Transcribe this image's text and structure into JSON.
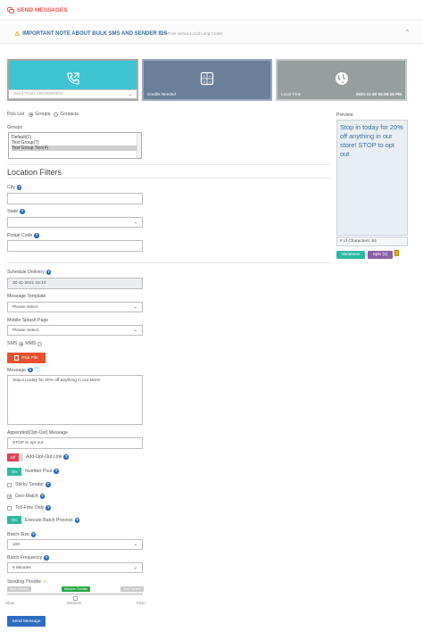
{
  "header": {
    "title": "SEND MESSAGES"
  },
  "note": {
    "title": "IMPORTANT NOTE ABOUT BULK SMS AND SENDER IDS",
    "subtitle": "Toll-Free versus Local Long Codes"
  },
  "tiles": {
    "send_from": {
      "value": "Send From: 18445283544"
    },
    "credits": {
      "label": "Credits Needed"
    },
    "local_time": {
      "label": "Local Time",
      "value": "2021-11-30 04:16:16 PM"
    }
  },
  "pick_list": {
    "label": "Pick List",
    "options": [
      "Groups",
      "Contacts"
    ],
    "selected": "Groups"
  },
  "groups": {
    "label": "Groups",
    "items": [
      "Default(1)",
      "Test Group(7)",
      "Test Group Two(4)"
    ],
    "selected": "Test Group Two(4)"
  },
  "location": {
    "title": "Location Filters",
    "city_label": "City",
    "state_label": "State",
    "postal_label": "Postal Code"
  },
  "schedule": {
    "label": "Schedule Delivery",
    "value": "30-11-2021 16:10"
  },
  "template": {
    "label": "Message Template",
    "value": "Please select"
  },
  "splash": {
    "label": "Mobile Splash Page",
    "value": "Please Select"
  },
  "msg_type": {
    "options": [
      "SMS",
      "MMS"
    ],
    "selected": "SMS"
  },
  "pick_file": {
    "label": "Pick File"
  },
  "message": {
    "label": "Message",
    "value": "Stop in today for 20% off anything in our store!"
  },
  "appended": {
    "label": "Appended(Opt-Out) Message",
    "value": "STOP to opt out"
  },
  "opt_out_link": {
    "toggle": "Off",
    "label": "Add-Opt-Out Link"
  },
  "number_pool": {
    "toggle": "On",
    "label": "Number Pool"
  },
  "sticky_sender": {
    "label": "Sticky Sender",
    "checked": false
  },
  "geo_match": {
    "label": "Geo-Match",
    "checked": true
  },
  "toll_free": {
    "label": "Toll-Free Only",
    "checked": false
  },
  "batch_process": {
    "toggle": "On",
    "label": "Execute Batch Process"
  },
  "batch_size": {
    "label": "Batch Size",
    "value": "100"
  },
  "batch_freq": {
    "label": "Batch Frequency",
    "value": "5 Minutes"
  },
  "throttle": {
    "label": "Sending Throttle",
    "tags": [
      "Slow Throttle",
      "Medium Throttle",
      "Fast Throttle"
    ],
    "ticks": [
      "Slow",
      "Medium",
      "Fast"
    ],
    "level": 0.5
  },
  "send_button": {
    "label": "Send Message"
  },
  "preview": {
    "label": "Preview",
    "text": "Stop in today for 20% off anything in our store! STOP to opt out",
    "chars": "# of Characters: 64"
  },
  "variations": {
    "label": "Variations"
  },
  "spin": {
    "label": "Spin {2}"
  },
  "colors": {
    "accent_red": "#e8524a",
    "teal": "#3cc4d3",
    "slate": "#6b7f99",
    "gray": "#979e9e",
    "button_blue": "#2d6cc0"
  }
}
